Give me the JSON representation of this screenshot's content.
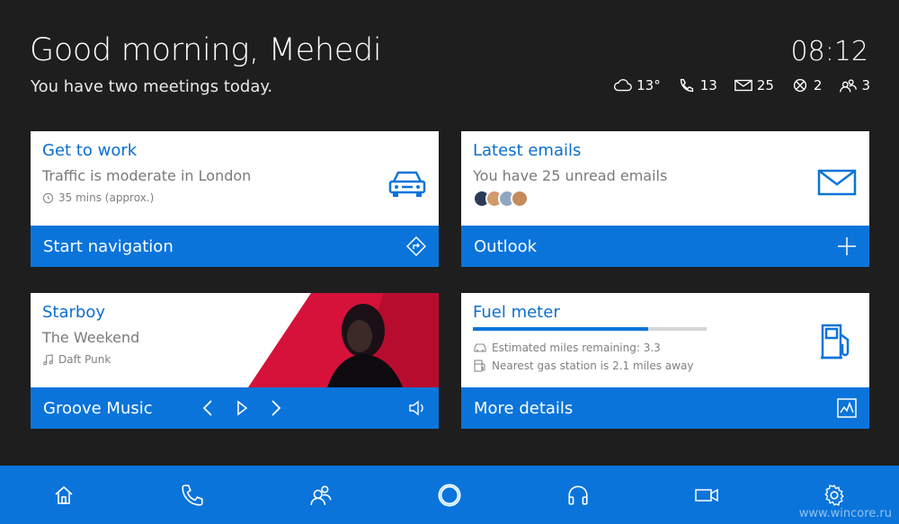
{
  "header": {
    "greeting": "Good morning, Mehedi",
    "subtitle": "You have two meetings today.",
    "clock": "08:12"
  },
  "status": {
    "weather": "13°",
    "calls": "13",
    "mail": "25",
    "xbox": "2",
    "people": "3"
  },
  "cards": {
    "work": {
      "title": "Get to work",
      "line": "Traffic is moderate in London",
      "meta": "35 mins (approx.)",
      "footer": "Start navigation"
    },
    "emails": {
      "title": "Latest emails",
      "line": "You have 25 unread emails",
      "footer": "Outlook"
    },
    "music": {
      "title": "Starboy",
      "artist": "The Weekend",
      "meta": "Daft Punk",
      "footer": "Groove Music"
    },
    "fuel": {
      "title": "Fuel meter",
      "level": 0.75,
      "miles": "Estimated miles remaining: 3.3",
      "station": "Nearest gas station is 2.1 miles away",
      "footer": "More details"
    }
  },
  "watermark": "www.wincore.ru",
  "colors": {
    "accent": "#0a74da",
    "title": "#0a6fd0",
    "background": "#1e1e1e"
  }
}
